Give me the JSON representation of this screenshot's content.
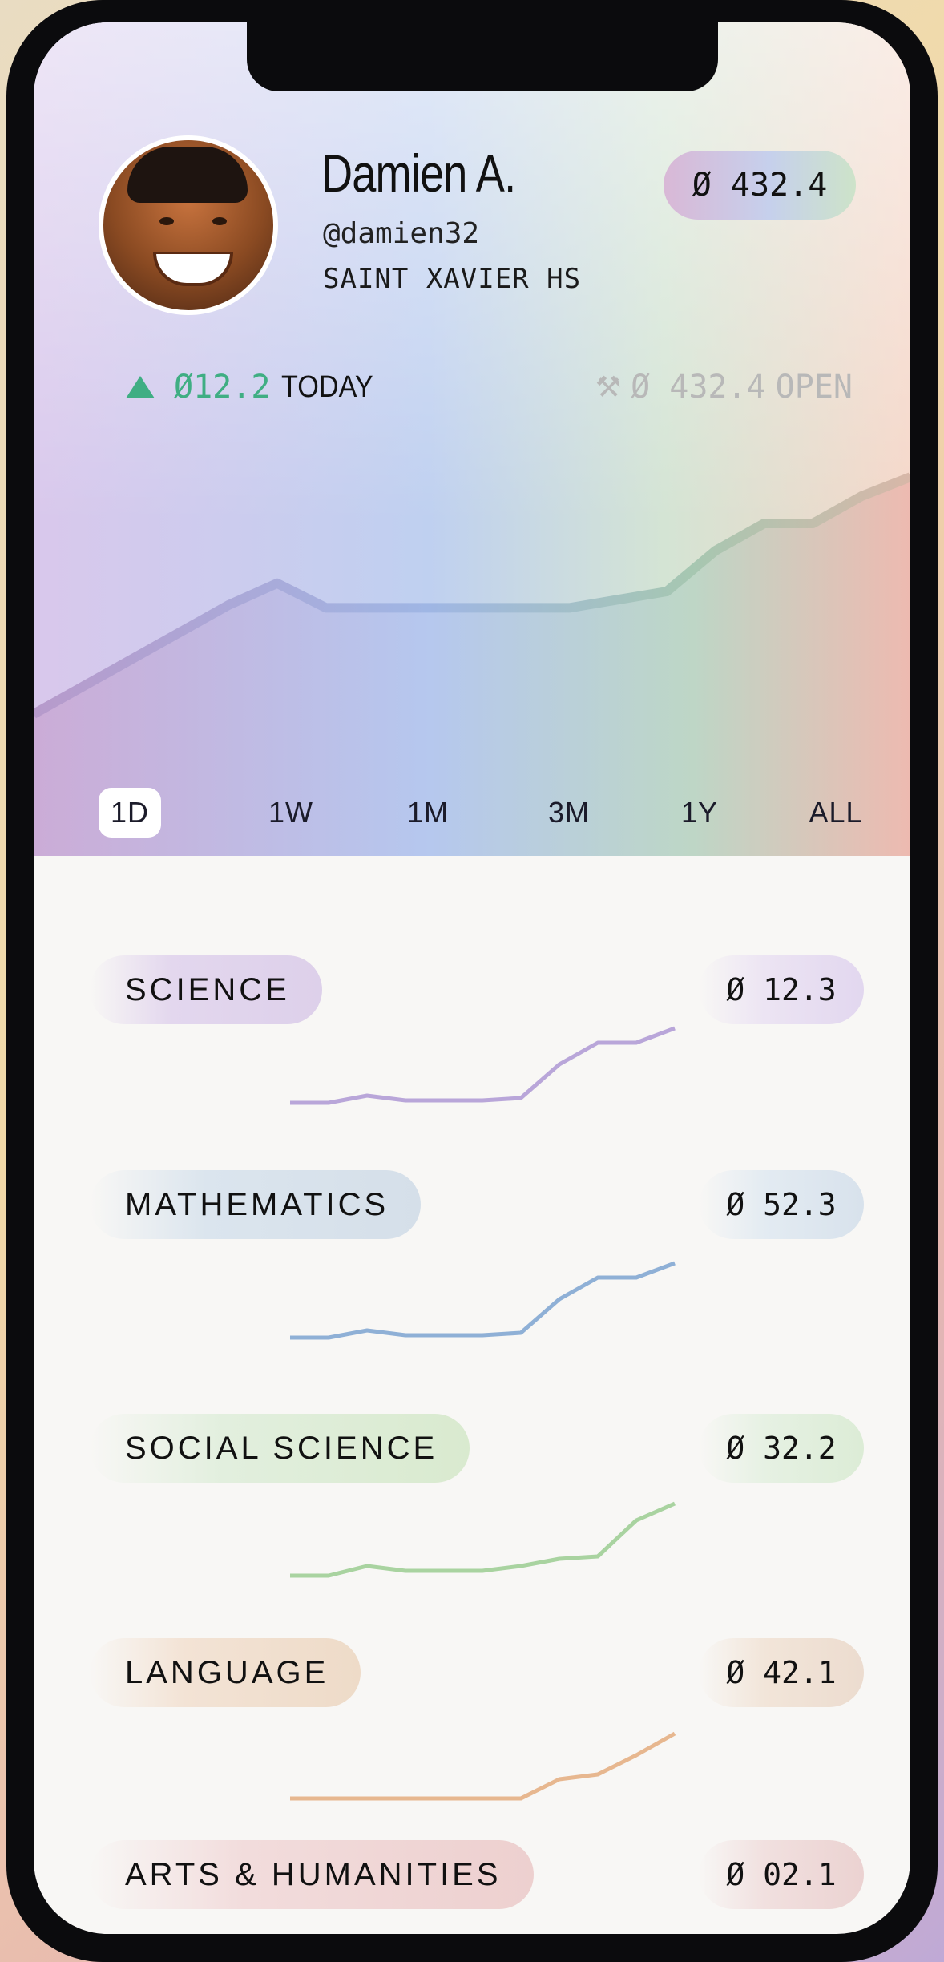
{
  "profile": {
    "name": "Damien A.",
    "handle": "@damien32",
    "school": "SAINT XAVIER HS",
    "balance": "Ø 432.4"
  },
  "performance": {
    "today_value": "Ø12.2",
    "today_label": "TODAY",
    "today_direction": "up",
    "open_value": "Ø 432.4",
    "open_label": "OPEN",
    "open_icon": "pickaxe-icon"
  },
  "time_ranges": {
    "selected": "1D",
    "items": [
      {
        "label": "1D"
      },
      {
        "label": "1W"
      },
      {
        "label": "1M"
      },
      {
        "label": "3M"
      },
      {
        "label": "1Y"
      },
      {
        "label": "ALL"
      }
    ]
  },
  "subjects": [
    {
      "name": "SCIENCE",
      "score": "Ø 12.3",
      "color": "#b9a6d9",
      "trend": [
        8,
        8,
        14,
        10,
        10,
        10,
        12,
        40,
        58,
        58,
        70
      ]
    },
    {
      "name": "MATHEMATICS",
      "score": "Ø 52.3",
      "color": "#8fb0d6",
      "trend": [
        8,
        8,
        14,
        10,
        10,
        10,
        12,
        40,
        58,
        58,
        70
      ]
    },
    {
      "name": "SOCIAL SCIENCE",
      "score": "Ø 32.2",
      "color": "#a9d3a0",
      "trend": [
        6,
        6,
        14,
        10,
        10,
        10,
        14,
        20,
        22,
        52,
        66
      ]
    },
    {
      "name": "LANGUAGE",
      "score": "Ø 42.1",
      "color": "#e7b78f",
      "trend": [
        4,
        4,
        4,
        4,
        4,
        4,
        4,
        20,
        24,
        40,
        58
      ]
    },
    {
      "name": "ARTS & HUMANITIES",
      "score": "Ø 02.1",
      "color": "#e9b3b3",
      "trend": []
    }
  ],
  "chart_data": {
    "type": "area",
    "title": "",
    "range": "1D",
    "values": [
      385,
      395,
      405,
      415,
      425,
      433,
      424,
      424,
      424,
      424,
      424,
      424,
      427,
      430,
      445,
      455,
      455,
      465,
      472
    ]
  },
  "colors": {
    "up_green": "#3fae83",
    "muted_gray": "#b8b8b8"
  }
}
